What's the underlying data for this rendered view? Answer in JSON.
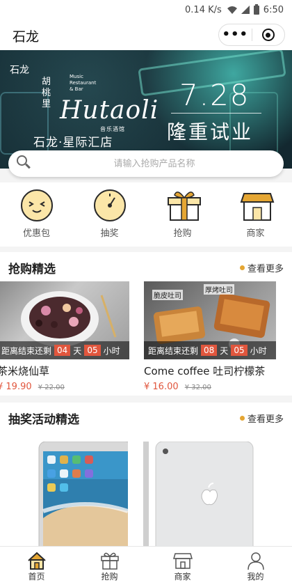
{
  "status_bar": {
    "speed": "0.14 K/s",
    "time": "6:50"
  },
  "nav": {
    "title": "石龙",
    "more_label": "•••"
  },
  "banner": {
    "city": "石龙",
    "logo_vertical": "胡桃里",
    "logo_brand": "Hutaoli",
    "logo_tiny": "Music Restaurant & Bar",
    "logo_sub": "音乐酒馆",
    "subtitle": "石龙·星际汇店",
    "date": "7.28",
    "headline": "隆重试业"
  },
  "search": {
    "placeholder": "请输入抢购产品名称"
  },
  "categories": [
    {
      "label": "优惠包",
      "icon": "coupon-face-icon"
    },
    {
      "label": "抽奖",
      "icon": "clock-dial-icon"
    },
    {
      "label": "抢购",
      "icon": "gift-box-icon"
    },
    {
      "label": "商家",
      "icon": "shop-icon"
    }
  ],
  "flash_sale": {
    "title": "抢购精选",
    "more": "查看更多",
    "items": [
      {
        "name": "茶米烧仙草",
        "price": "¥ 19.90",
        "orig": "¥ 22.00",
        "countdown_label": "距离结束还剩",
        "days": "04",
        "day_unit": "天",
        "hours": "05",
        "hour_unit": "小时"
      },
      {
        "name": "Come coffee 吐司柠檬茶",
        "price": "¥ 16.00",
        "orig": "¥ 32.00",
        "countdown_label": "距离结束还剩",
        "days": "08",
        "day_unit": "天",
        "hours": "05",
        "hour_unit": "小时",
        "tag1": "脆皮吐司",
        "tag2": "厚烤吐司"
      }
    ]
  },
  "lottery": {
    "title": "抽奖活动精选",
    "more": "查看更多"
  },
  "tabbar": [
    {
      "label": "首页",
      "icon": "home-icon"
    },
    {
      "label": "抢购",
      "icon": "gift-box-icon"
    },
    {
      "label": "商家",
      "icon": "shop-icon"
    },
    {
      "label": "我的",
      "icon": "user-icon"
    }
  ],
  "colors": {
    "accent": "#e5a633",
    "price": "#e1563d"
  }
}
